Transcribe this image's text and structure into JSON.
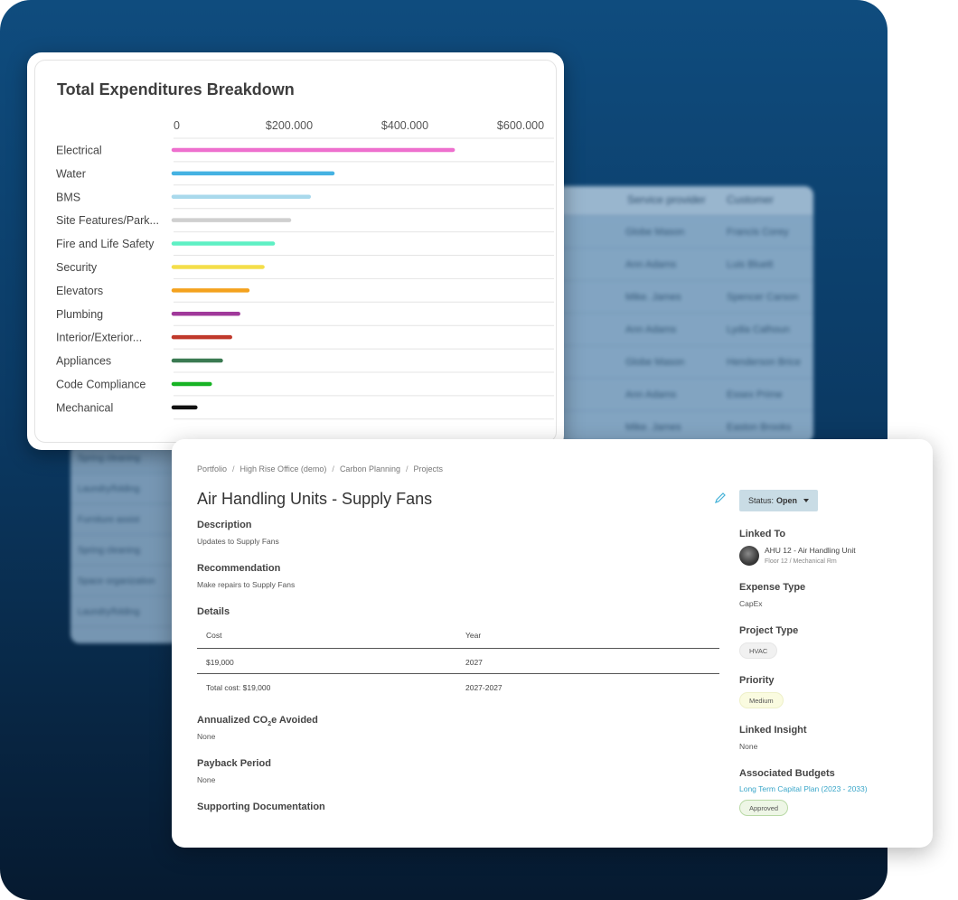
{
  "background_table": {
    "headers": [
      "Service provider",
      "Customer"
    ],
    "rows": [
      [
        "Globe Mason",
        "Francis Corey"
      ],
      [
        "Ann Adams",
        "Luis Bluett"
      ],
      [
        "Mike. James",
        "Spencer Carson"
      ],
      [
        "Ann Adams",
        "Lydia Calhoun"
      ],
      [
        "Globe Mason",
        "Henderson Brice"
      ],
      [
        "Ann Adams",
        "Essex Prime"
      ],
      [
        "Mike. James",
        "Easton Brooks"
      ]
    ],
    "left_rows": [
      "Spring cleaning",
      "Laundry/folding",
      "Furniture assist",
      "Spring cleaning",
      "Space organization",
      "Laundry/folding"
    ]
  },
  "chart_data": {
    "type": "bar",
    "orientation": "horizontal",
    "title": "Total Expenditures Breakdown",
    "xlabel": "",
    "ylabel": "",
    "xlim": [
      0,
      600000
    ],
    "xticks": [
      {
        "value": 0,
        "label": "0"
      },
      {
        "value": 200000,
        "label": "$200.000"
      },
      {
        "value": 400000,
        "label": "$400.000"
      },
      {
        "value": 600000,
        "label": "$600.000"
      }
    ],
    "categories": [
      "Electrical",
      "Water",
      "BMS",
      "Site Features/Park...",
      "Fire and Life Safety",
      "Security",
      "Elevators",
      "Plumbing",
      "Interior/Exterior...",
      "Appliances",
      "Code Compliance",
      "Mechanical"
    ],
    "values": [
      483000,
      275000,
      234000,
      200000,
      172000,
      154000,
      128000,
      112000,
      98000,
      82000,
      63000,
      38000
    ],
    "colors": [
      "#ee6fce",
      "#45b2e2",
      "#a9d9ec",
      "#cfcfcf",
      "#5ef0c4",
      "#f4de4a",
      "#f4a21e",
      "#a0399a",
      "#c0392b",
      "#3a7a52",
      "#17b324",
      "#111111"
    ],
    "grid": true,
    "legend": "none"
  },
  "detail": {
    "breadcrumb": [
      "Portfolio",
      "High Rise Office (demo)",
      "Carbon Planning",
      "Projects"
    ],
    "breadcrumb_sep": "/",
    "title": "Air Handling Units - Supply Fans",
    "status_label": "Status:",
    "status_value": "Open",
    "description_label": "Description",
    "description_value": "Updates to Supply Fans",
    "recommendation_label": "Recommendation",
    "recommendation_value": "Make repairs to Supply Fans",
    "details_label": "Details",
    "details_table": {
      "headers": [
        "Cost",
        "Year"
      ],
      "rows": [
        [
          "$19,000",
          "2027"
        ]
      ],
      "total": [
        "Total cost: $19,000",
        "2027-2027"
      ]
    },
    "co2_label_prefix": "Annualized CO",
    "co2_label_sub": "2",
    "co2_label_suffix": "e Avoided",
    "co2_value": "None",
    "payback_label": "Payback Period",
    "payback_value": "None",
    "supporting_label": "Supporting Documentation",
    "linked_to_label": "Linked To",
    "linked_to_name": "AHU 12 - Air Handling Unit",
    "linked_to_sub": "Floor 12 / Mechanical Rm",
    "expense_type_label": "Expense Type",
    "expense_type_value": "CapEx",
    "project_type_label": "Project Type",
    "project_type_value": "HVAC",
    "priority_label": "Priority",
    "priority_value": "Medium",
    "linked_insight_label": "Linked Insight",
    "linked_insight_value": "None",
    "budgets_label": "Associated Budgets",
    "budgets_link": "Long Term Capital Plan (2023 - 2033)",
    "budgets_status": "Approved"
  }
}
